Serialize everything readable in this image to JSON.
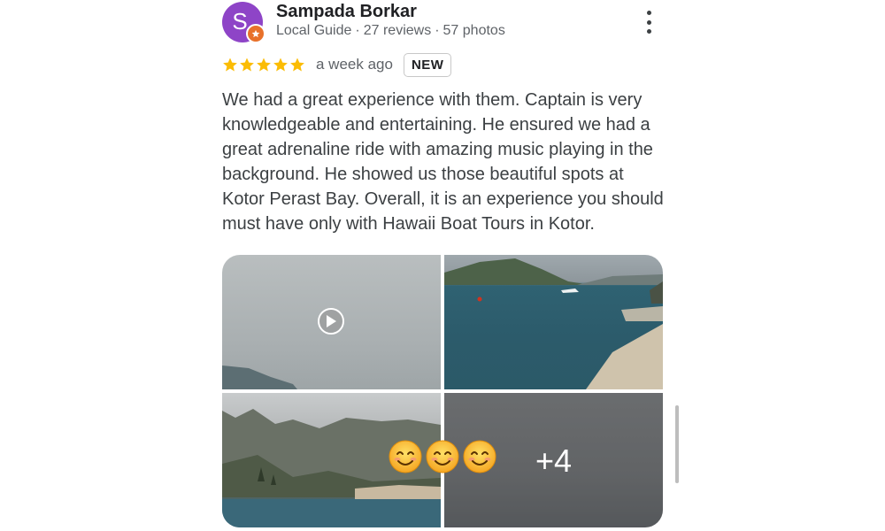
{
  "reviewer": {
    "initial": "S",
    "name": "Sampada Borkar",
    "level": "Local Guide",
    "reviews": "27 reviews",
    "photos": "57 photos",
    "separator": "·"
  },
  "rating": {
    "stars": 5,
    "max_stars": 5,
    "time": "a week ago",
    "badge": "NEW"
  },
  "review": {
    "text": "We had a great experience with them. Captain is very knowledgeable and entertaining. He ensured we had a great adrenaline ride with amazing music playing in the background. He showed us those beautiful spots at Kotor Perast Bay. Overall, it is an experience you should must have only with Hawaii Boat Tours in Kotor."
  },
  "media": {
    "more_count": "+4",
    "emoji_reactions": 3,
    "first_is_video": true
  },
  "colors": {
    "avatar": "#8e44c7",
    "guide_badge": "#e8712a",
    "star": "#fbbc04",
    "text_secondary": "#5f6368"
  },
  "icons": {
    "more": "more-vert-icon",
    "star": "star-icon",
    "play": "play-icon",
    "guide": "local-guide-star-icon",
    "reaction": "smiling-face-emoji"
  }
}
